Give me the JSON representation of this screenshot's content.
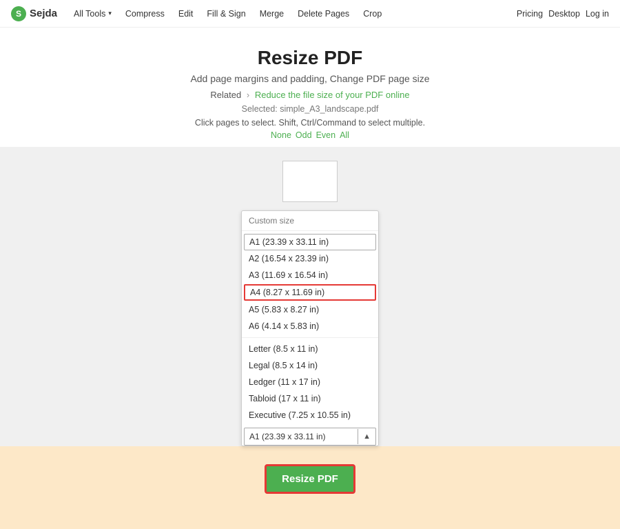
{
  "nav": {
    "logo_letter": "S",
    "logo_text": "Sejda",
    "links": [
      {
        "label": "All Tools",
        "has_dropdown": true
      },
      {
        "label": "Compress",
        "has_dropdown": false
      },
      {
        "label": "Edit",
        "has_dropdown": false
      },
      {
        "label": "Fill & Sign",
        "has_dropdown": false
      },
      {
        "label": "Merge",
        "has_dropdown": false
      },
      {
        "label": "Delete Pages",
        "has_dropdown": false
      },
      {
        "label": "Crop",
        "has_dropdown": false
      }
    ],
    "right_links": [
      {
        "label": "Pricing"
      },
      {
        "label": "Desktop"
      },
      {
        "label": "Log in"
      }
    ]
  },
  "hero": {
    "title": "Resize PDF",
    "subtitle": "Add page margins and padding, Change PDF page size",
    "related_prefix": "Related",
    "related_link_text": "Reduce the file size of your PDF online",
    "selected_label": "Selected: simple_A3_landscape.pdf",
    "instruction": "Click pages to select. Shift, Ctrl/Command to select multiple.",
    "select_links": [
      "None",
      "Odd",
      "Even",
      "All"
    ]
  },
  "dropdown": {
    "header": "Custom size",
    "items": [
      {
        "label": "A1 (23.39 x 33.11 in)",
        "state": "first"
      },
      {
        "label": "A2 (16.54 x 23.39 in)",
        "state": "normal"
      },
      {
        "label": "A3 (11.69 x 16.54 in)",
        "state": "normal"
      },
      {
        "label": "A4 (8.27 x 11.69 in)",
        "state": "selected-border"
      },
      {
        "label": "A5 (5.83 x 8.27 in)",
        "state": "normal"
      },
      {
        "label": "A6 (4.14 x 5.83 in)",
        "state": "normal"
      },
      {
        "label": "Letter (8.5 x 11 in)",
        "state": "normal"
      },
      {
        "label": "Legal (8.5 x 14 in)",
        "state": "normal"
      },
      {
        "label": "Ledger (11 x 17 in)",
        "state": "normal"
      },
      {
        "label": "Tabloid (17 x 11 in)",
        "state": "normal"
      },
      {
        "label": "Executive (7.25 x 10.55 in)",
        "state": "normal"
      }
    ],
    "select_value": "A1 (23.39 x 33.11 in)"
  },
  "resize_button": "Resize PDF"
}
